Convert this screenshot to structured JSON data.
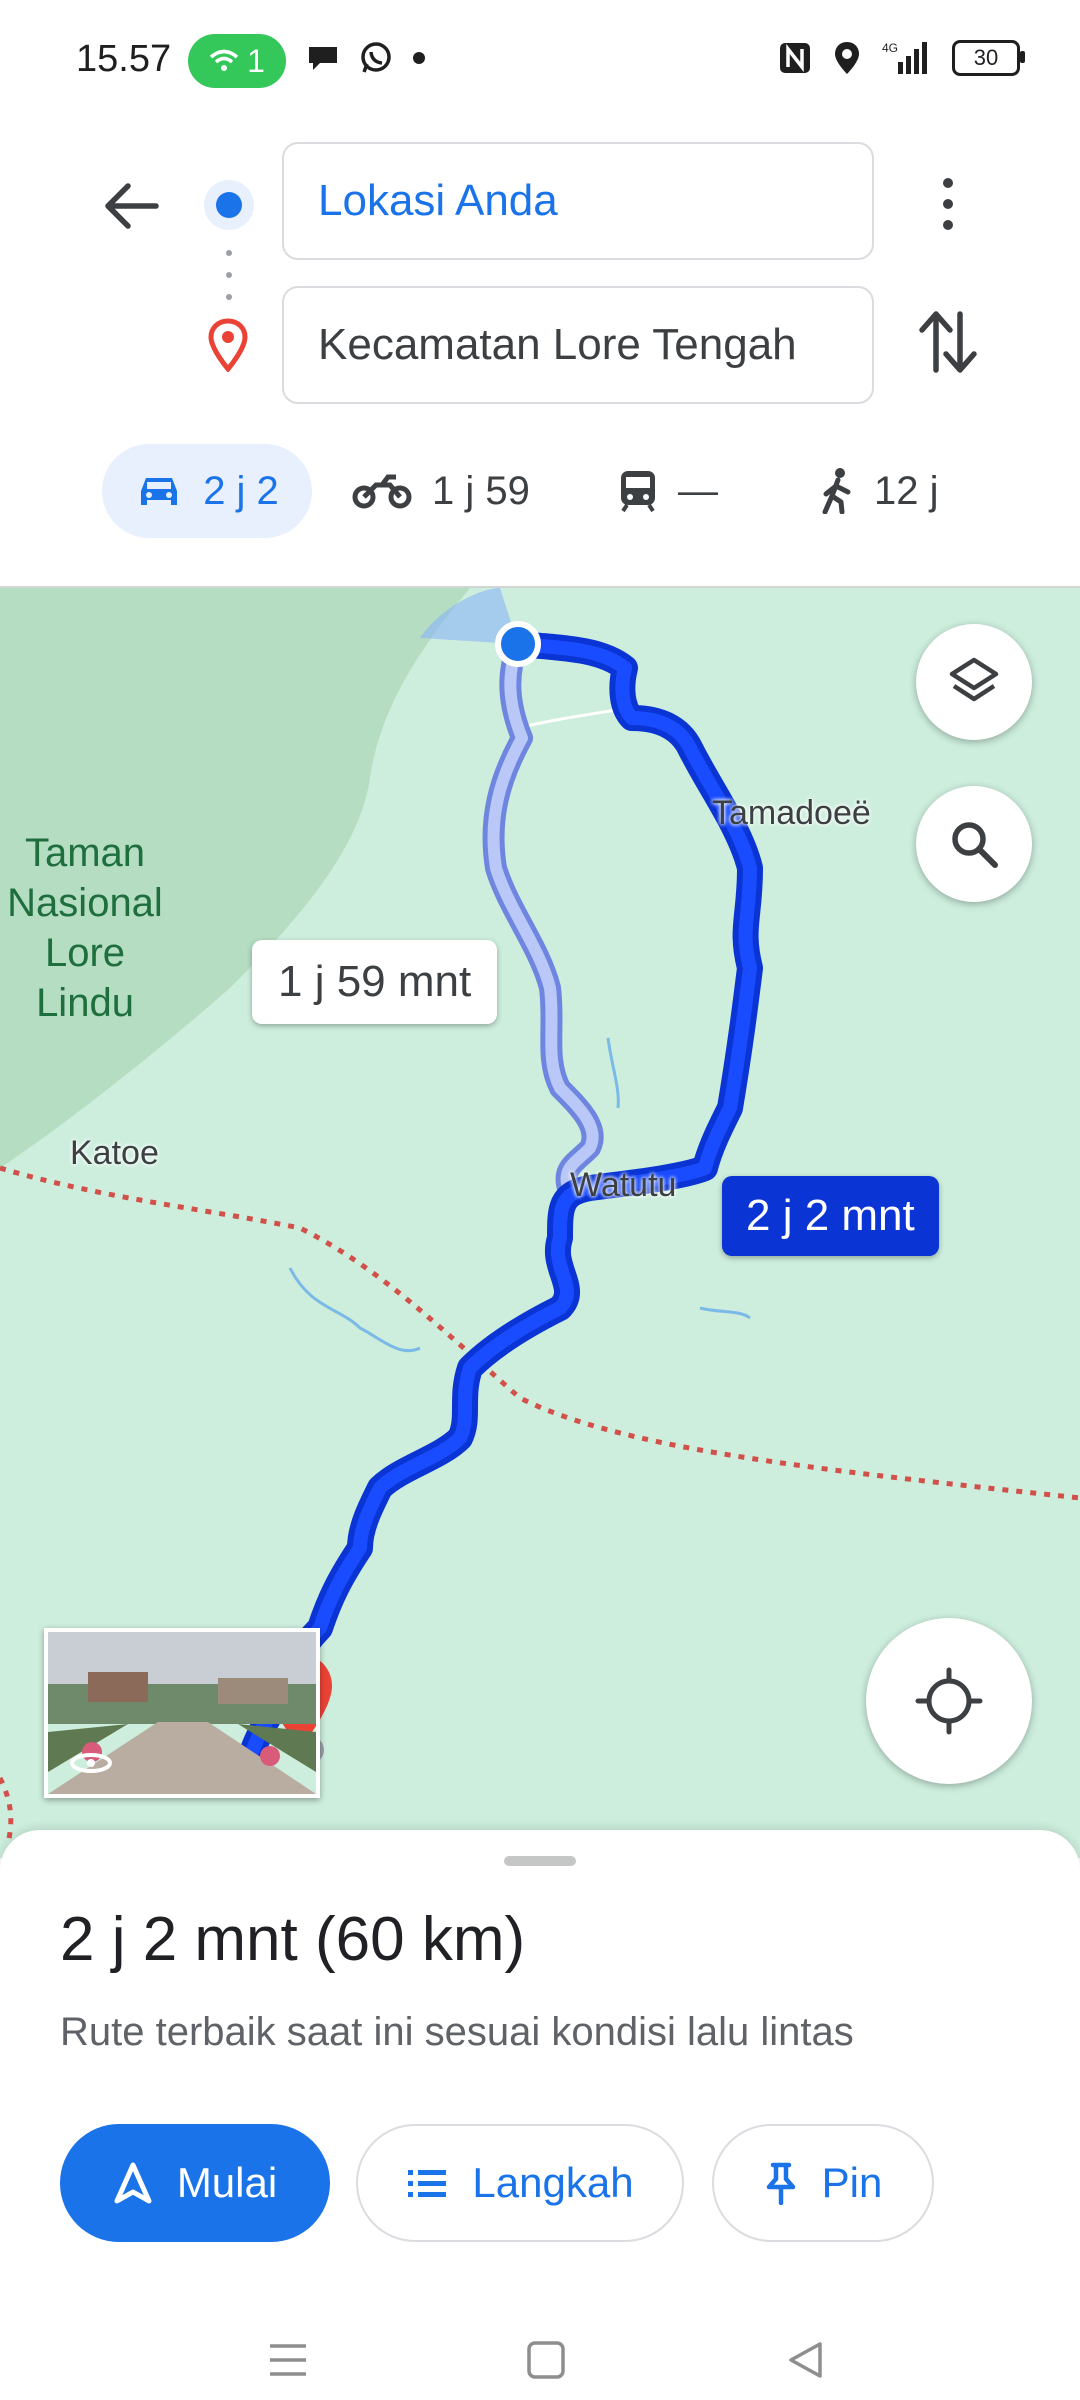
{
  "status_bar": {
    "time": "15.57",
    "wifi_count": "1",
    "battery": "30",
    "network": "4G"
  },
  "directions": {
    "origin": "Lokasi Anda",
    "destination": "Kecamatan Lore Tengah"
  },
  "modes": [
    {
      "name": "car",
      "label": "2 j 2"
    },
    {
      "name": "motorcycle",
      "label": "1 j 59"
    },
    {
      "name": "transit",
      "label": "—"
    },
    {
      "name": "walk",
      "label": "12 j"
    }
  ],
  "map": {
    "park_label_lines": [
      "Taman",
      "Nasional",
      "Lore Lindu"
    ],
    "places": {
      "tamadoe": "Tamadoeë",
      "katoe": "Katoe",
      "watutu": "Watutu"
    },
    "alt_route_label": "1 j 59 mnt",
    "main_route_label": "2 j 2 mnt"
  },
  "sheet": {
    "summary": "2 j 2 mnt (60 km)",
    "subtitle": "Rute terbaik saat ini sesuai kondisi lalu lintas",
    "start_label": "Mulai",
    "steps_label": "Langkah",
    "pin_label": "Pin"
  },
  "colors": {
    "accent": "#1a73e8",
    "route_main": "#0b34d4",
    "route_alt": "#a9bdf5",
    "map_bg": "#cdeedd",
    "park": "#b5ddc2",
    "destination_pin": "#ea4335"
  }
}
